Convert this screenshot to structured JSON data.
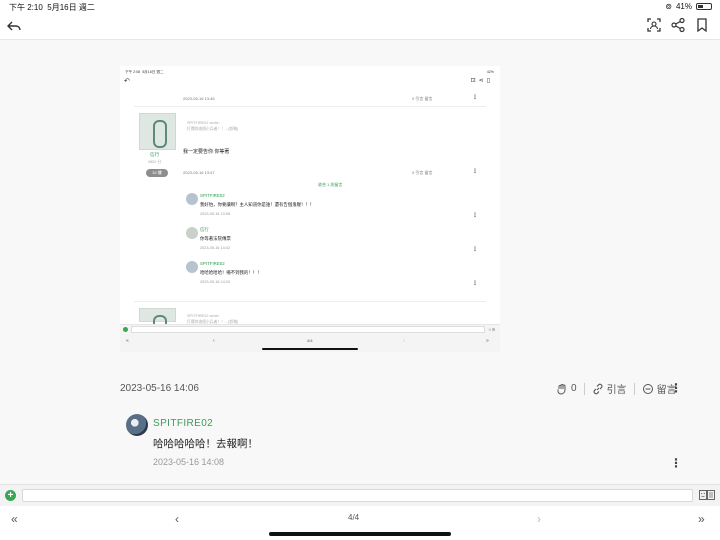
{
  "status": {
    "time": "下午 2:10",
    "date": "5月16日 週二",
    "battery": "41%"
  },
  "toolbar": {
    "back_icon": "reply-back-icon",
    "scan_icon": "scan-icon",
    "share_icon": "share-icon",
    "bookmark_icon": "bookmark-icon"
  },
  "embedded": {
    "status_time": "下午 2:08",
    "status_date": "5月16日 週二",
    "status_right": "42%",
    "post1_date": "2023-05-16 13:46",
    "post1_meta": "0 引言 留言",
    "user_sig_1": "SPITFIRE02 wrote:",
    "user_sig_2": "打爛你這個小兵者！！...(恕略)",
    "user_name": "信行",
    "user_points": "9852 分",
    "floor": "32 樓",
    "post2_text": "我一定要告你 你等著",
    "post2_date": "2023-05-16 13:47",
    "post2_meta": "0 引言 留言",
    "show_replies": "收合 1 則留言",
    "replies": [
      {
        "name": "SPITFIRE02",
        "text": "我好怕，你要讓啊？主人知道你是誰！還有告個鬼喔！！！",
        "date": "2023-05-16 13:58"
      },
      {
        "name": "信行",
        "text": "你等著法院傳票",
        "date": "2023-05-16 14:02"
      },
      {
        "name": "SPITFIRE02",
        "text": "哈哈哈哈哈！嚇不到我的！！！",
        "date": "2023-05-16 14:03"
      }
    ],
    "next_sig_1": "SPITFIRE02 wrote:",
    "next_sig_2": "打爛你這個小兵者！！...(恕略)",
    "nav_page": "4/4",
    "emoji_label": "☺☰"
  },
  "post": {
    "date": "2023-05-16 14:06",
    "like_count": "0",
    "quote_label": "引言",
    "comment_label": "留言"
  },
  "reply": {
    "name": "SPITFIRE02",
    "text": "哈哈哈哈哈！去報啊！",
    "date": "2023-05-16 14:08"
  },
  "nav": {
    "first": "«",
    "prev": "‹",
    "page": "4/4",
    "next": "›",
    "last": "»"
  },
  "colors": {
    "accent_green": "#3b9c57",
    "plus_green": "#3aa655"
  }
}
